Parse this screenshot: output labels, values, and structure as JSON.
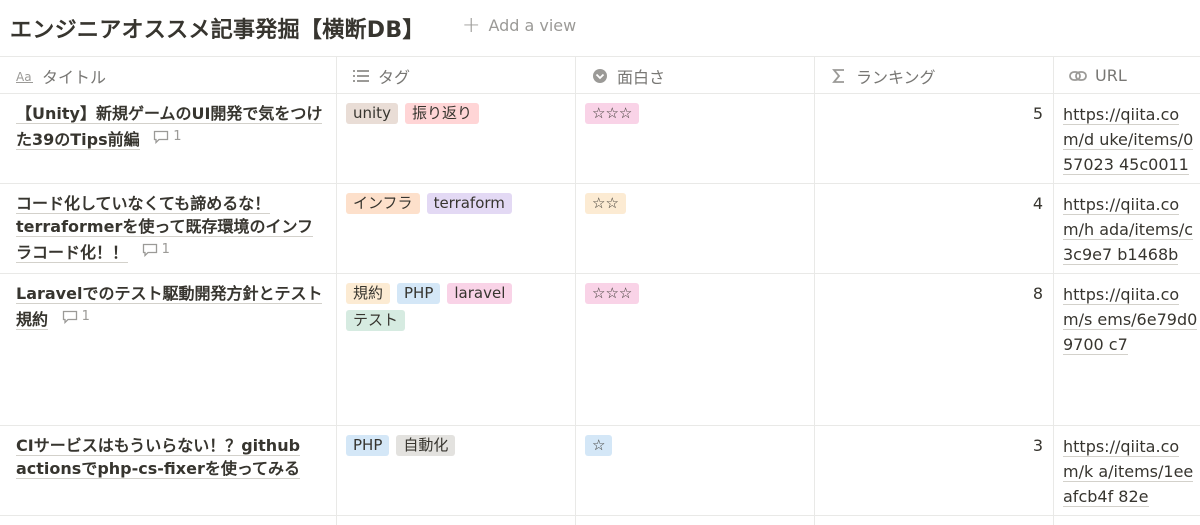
{
  "database": {
    "title": "エンジニアオススメ記事発掘【横断DB】",
    "add_view_label": "Add a view"
  },
  "columns": [
    {
      "label": "タイトル",
      "icon": "title-property-icon"
    },
    {
      "label": "タグ",
      "icon": "multi-select-list-icon"
    },
    {
      "label": "面白さ",
      "icon": "select-chevron-icon"
    },
    {
      "label": "ランキング",
      "icon": "formula-sigma-icon"
    },
    {
      "label": "URL",
      "icon": "link-icon"
    }
  ],
  "rows": [
    {
      "title": "【Unity】新規ゲームのUI開発で気をつけた39のTips前編",
      "comments": "1",
      "tags": [
        {
          "label": "unity",
          "color": "#e9ddd6"
        },
        {
          "label": "振り返り",
          "color": "#ffd5d6"
        }
      ],
      "rating": {
        "label": "☆☆☆",
        "color": "#f9d3e7"
      },
      "rank": "5",
      "url": "https://qiita.com/d uke/items/057023 45c0011"
    },
    {
      "title": "コード化していなくても諦めるな！terraformerを使って既存環境のインフラコード化！！",
      "comments": "1",
      "tags": [
        {
          "label": "インフラ",
          "color": "#fde0cb"
        },
        {
          "label": "terraform",
          "color": "#e3d9f4"
        }
      ],
      "rating": {
        "label": "☆☆",
        "color": "#fcebd3"
      },
      "rank": "4",
      "url": "https://qiita.com/h ada/items/c3c9e7 b1468b"
    },
    {
      "title": "Laravelでのテスト駆動開発方針とテスト規約",
      "comments": "1",
      "tags": [
        {
          "label": "規約",
          "color": "#fcebd3"
        },
        {
          "label": "PHP",
          "color": "#d4e7f7"
        },
        {
          "label": "laravel",
          "color": "#f9d3e7"
        },
        {
          "label": "テスト",
          "color": "#d6ebe1"
        }
      ],
      "rating": {
        "label": "☆☆☆",
        "color": "#f9d3e7"
      },
      "rank": "8",
      "url": "https://qiita.com/s ems/6e79d09700 c7"
    },
    {
      "title": "CIサービスはもういらない！？github actionsでphp-cs-fixerを使ってみる",
      "comments": "",
      "tags": [
        {
          "label": "PHP",
          "color": "#d4e7f7"
        },
        {
          "label": "自動化",
          "color": "#e3e2df"
        }
      ],
      "rating": {
        "label": "☆",
        "color": "#d4e7f7"
      },
      "rank": "3",
      "url": "https://qiita.com/k a/items/1eeafcb4f 82e"
    }
  ]
}
